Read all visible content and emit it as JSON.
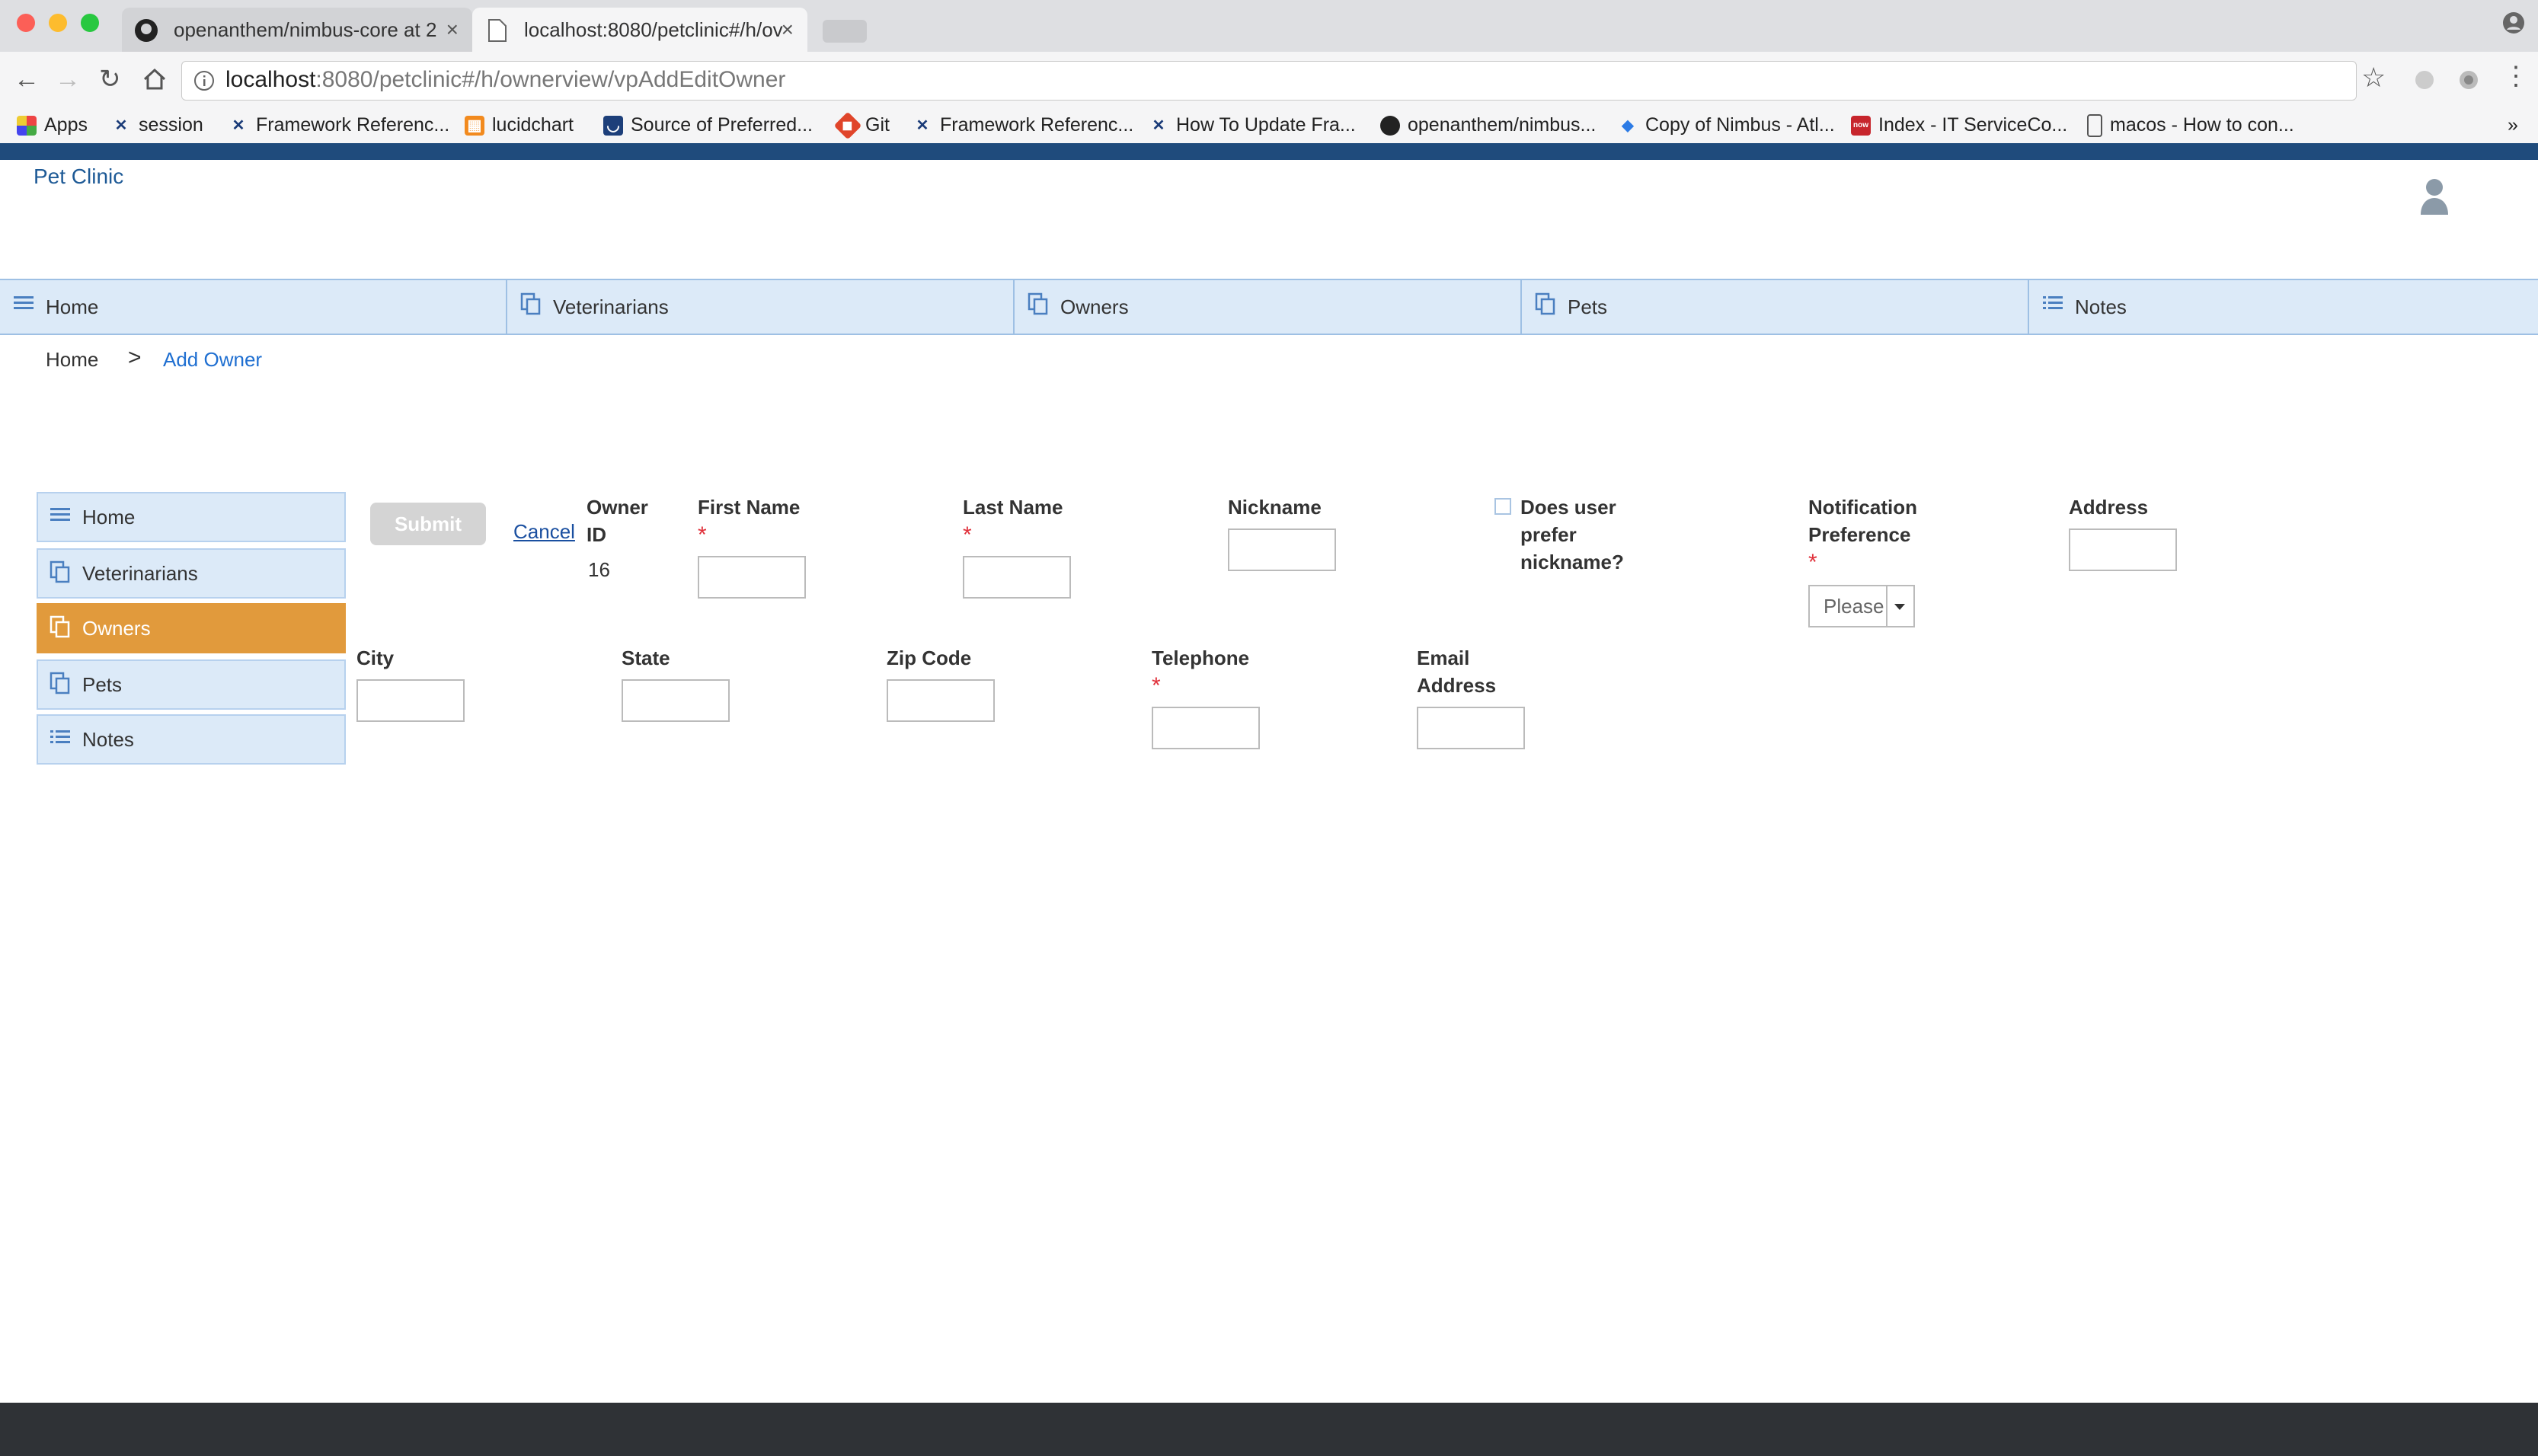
{
  "browser": {
    "tabs": [
      {
        "title": "openanthem/nimbus-core at 2",
        "close": "×"
      },
      {
        "title": "localhost:8080/petclinic#/h/ov",
        "close": "×"
      }
    ],
    "url_host": "localhost",
    "url_path": ":8080/petclinic#/h/ownerview/vpAddEditOwner",
    "bookmarks": [
      "Apps",
      "session",
      "Framework Referenc...",
      "lucidchart",
      "Source of Preferred...",
      "Git",
      "Framework Referenc...",
      "How To Update Fra...",
      "openanthem/nimbus...",
      "Copy of Nimbus - Atl...",
      "Index - IT ServiceCo...",
      "macos - How to con..."
    ],
    "bookmarks_more": "»"
  },
  "app": {
    "brand": "Pet Clinic",
    "main_nav": [
      "Home",
      "Veterinarians",
      "Owners",
      "Pets",
      "Notes"
    ],
    "breadcrumb": {
      "home": "Home",
      "separator": ">",
      "current": "Add Owner"
    },
    "side_nav": [
      "Home",
      "Veterinarians",
      "Owners",
      "Pets",
      "Notes"
    ],
    "active_side": "Owners",
    "form": {
      "submit": "Submit",
      "cancel": "Cancel",
      "owner_id_label_1": "Owner",
      "owner_id_label_2": "ID",
      "owner_id_value": "16",
      "first_name": "First Name",
      "last_name": "Last Name",
      "nickname": "Nickname",
      "prefer_nickname_1": "Does user",
      "prefer_nickname_2": "prefer",
      "prefer_nickname_3": "nickname?",
      "notification_1": "Notification",
      "notification_2": "Preference",
      "notification_select": "Please",
      "address": "Address",
      "city": "City",
      "state": "State",
      "zip": "Zip Code",
      "telephone": "Telephone",
      "email_1": "Email",
      "email_2": "Address",
      "required_mark": "*"
    }
  },
  "colors": {
    "accent_active": "#e19a3c",
    "topbar": "#1f4b7c",
    "nav_bg": "#dceaf8",
    "required": "#e0303a",
    "link": "#1f6fd1"
  }
}
